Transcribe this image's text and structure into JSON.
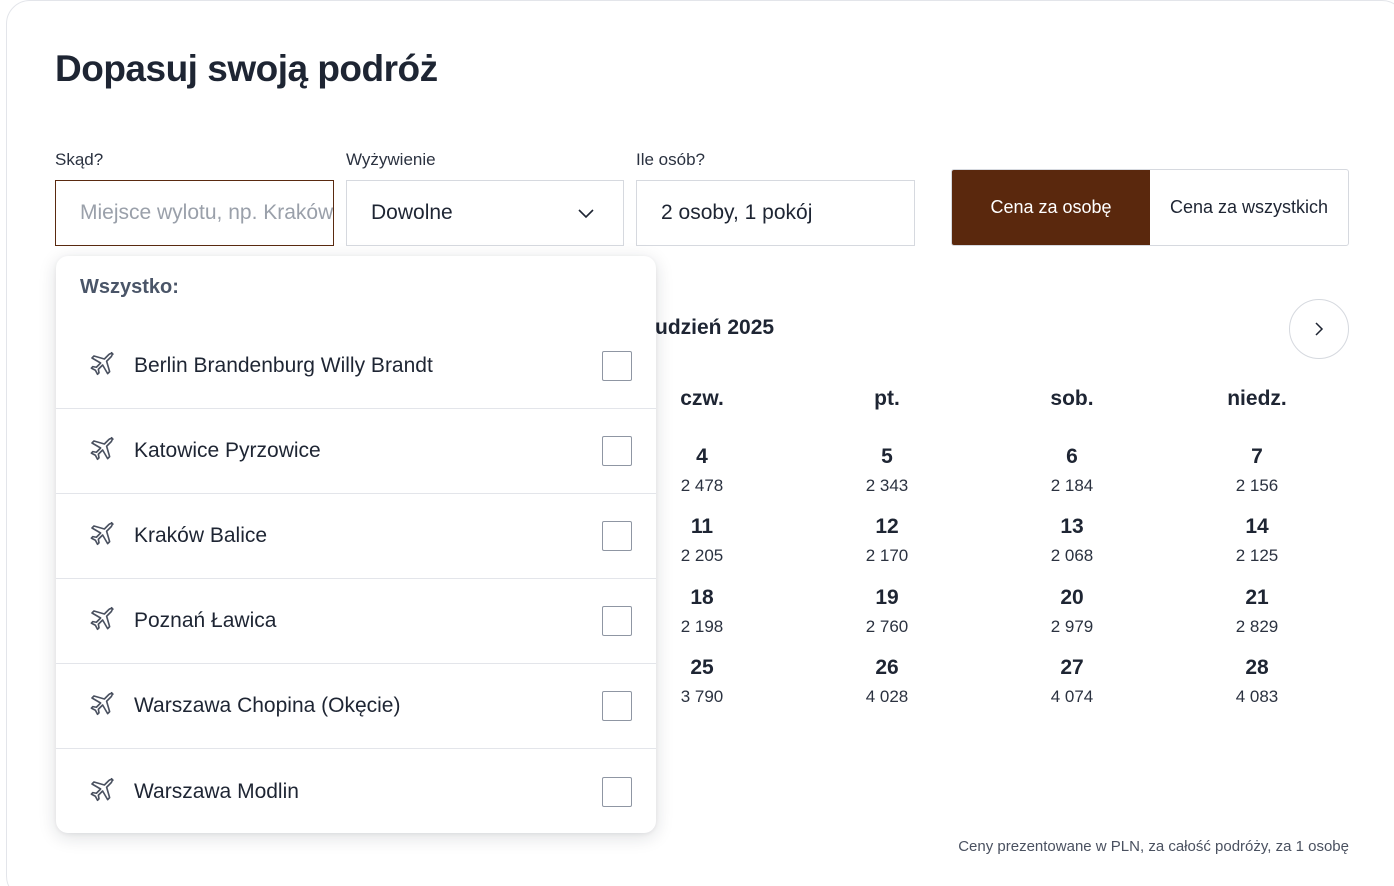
{
  "page": {
    "title": "Dopasuj swoją podróż"
  },
  "form": {
    "from_label": "Skąd?",
    "from_placeholder": "Miejsce wylotu, np. Kraków",
    "board_label": "Wyżywienie",
    "board_value": "Dowolne",
    "people_label": "Ile osób?",
    "people_value": "2 osoby, 1 pokój"
  },
  "price_toggle": {
    "per_person": "Cena za osobę",
    "total": "Cena za wszystkich",
    "selected": "per_person"
  },
  "calendar": {
    "month_visible": "udzień 2025",
    "weekdays": [
      "czw.",
      "pt.",
      "sob.",
      "niedz."
    ],
    "weeks": [
      [
        {
          "day": "4",
          "price": "2 478"
        },
        {
          "day": "5",
          "price": "2 343"
        },
        {
          "day": "6",
          "price": "2 184"
        },
        {
          "day": "7",
          "price": "2 156"
        }
      ],
      [
        {
          "day": "11",
          "price": "2 205"
        },
        {
          "day": "12",
          "price": "2 170"
        },
        {
          "day": "13",
          "price": "2 068"
        },
        {
          "day": "14",
          "price": "2 125"
        }
      ],
      [
        {
          "day": "18",
          "price": "2 198"
        },
        {
          "day": "19",
          "price": "2 760"
        },
        {
          "day": "20",
          "price": "2 979"
        },
        {
          "day": "21",
          "price": "2 829"
        }
      ],
      [
        {
          "day": "25",
          "price": "3 790"
        },
        {
          "day": "26",
          "price": "4 028"
        },
        {
          "day": "27",
          "price": "4 074"
        },
        {
          "day": "28",
          "price": "4 083"
        }
      ]
    ]
  },
  "footnote": "Ceny prezentowane w PLN, za całość podróży, za 1 osobę",
  "dropdown": {
    "heading": "Wszystko:",
    "airports": [
      {
        "name": "Berlin Brandenburg Willy Brandt",
        "checked": false
      },
      {
        "name": "Katowice Pyrzowice",
        "checked": false
      },
      {
        "name": "Kraków Balice",
        "checked": false
      },
      {
        "name": "Poznań Ławica",
        "checked": false
      },
      {
        "name": "Warszawa Chopina (Okęcie)",
        "checked": false
      },
      {
        "name": "Warszawa Modlin",
        "checked": false
      }
    ]
  },
  "colors": {
    "accent": "#5a280d",
    "border": "#d6d9df",
    "text": "#1e2533"
  },
  "icons": {
    "airport": "plane-icon",
    "select": "chevron-down-icon",
    "next": "chevron-right-icon"
  }
}
